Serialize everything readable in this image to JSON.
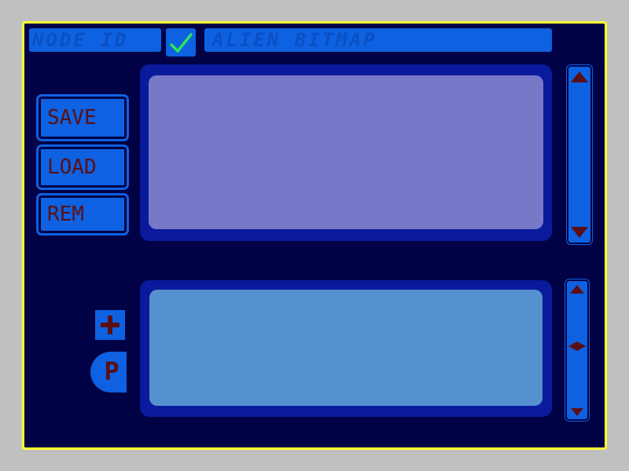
{
  "header": {
    "node_id_label": "NODE ID",
    "title": "ALIEN BITMAP",
    "checkbox_checked": true
  },
  "buttons": {
    "save_label": "SAVE",
    "load_label": "LOAD",
    "rem_label": "REM",
    "add_label": "+",
    "p_label": "P"
  },
  "colors": {
    "frame_border": "#ffff2e",
    "background": "#010245",
    "control": "#0e61e0",
    "upper_panel": "#7878c8",
    "lower_panel": "#5590cf",
    "panel_frame": "#0a1a9c",
    "glyph": "#5a0f15",
    "check": "#29e55a"
  },
  "icons": {
    "checkbox": "check-icon",
    "scroll_up": "arrow-up-icon",
    "scroll_down": "arrow-down-icon",
    "scroll_mid": "diamond-icon",
    "add": "plus-icon",
    "p": "p-icon"
  }
}
